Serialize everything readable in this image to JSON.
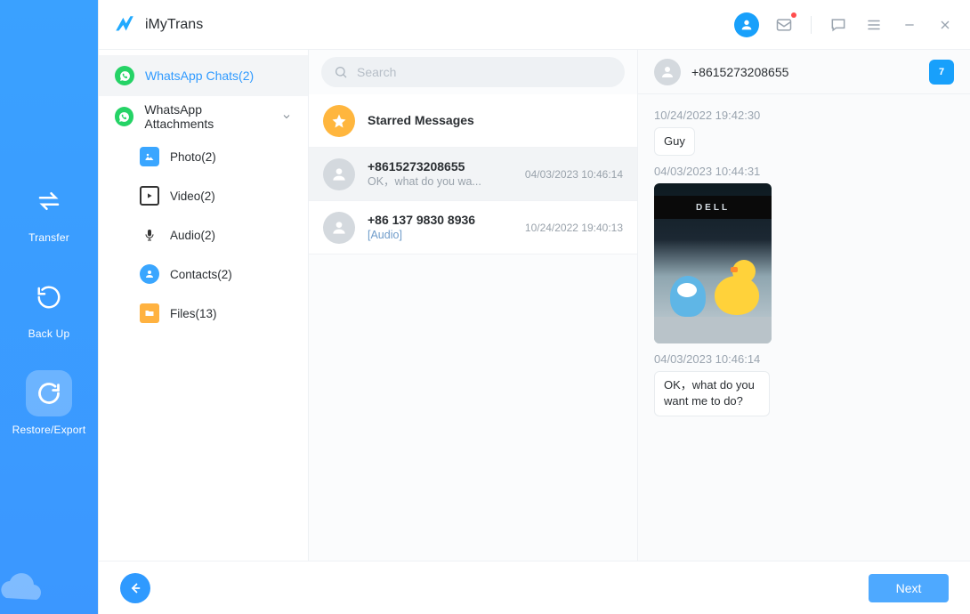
{
  "app": {
    "name": "iMyTrans"
  },
  "rail": {
    "items": [
      {
        "id": "transfer",
        "label": "Transfer"
      },
      {
        "id": "backup",
        "label": "Back Up"
      },
      {
        "id": "restore",
        "label": "Restore/Export"
      }
    ]
  },
  "tree": {
    "chats": {
      "label": "WhatsApp Chats(2)"
    },
    "attachments": {
      "label": "WhatsApp Attachments"
    },
    "photo": {
      "label": "Photo(2)"
    },
    "video": {
      "label": "Video(2)"
    },
    "audio": {
      "label": "Audio(2)"
    },
    "contacts": {
      "label": "Contacts(2)"
    },
    "files": {
      "label": "Files(13)"
    }
  },
  "search": {
    "placeholder": "Search"
  },
  "conversations": {
    "starred": {
      "title": "Starred Messages"
    },
    "items": [
      {
        "title": "+8615273208655",
        "preview": "OK，what do you wa...",
        "time": "04/03/2023 10:46:14"
      },
      {
        "title": "+86 137 9830 8936",
        "preview": "[Audio]",
        "time": "10/24/2022 19:40:13"
      }
    ]
  },
  "chat": {
    "header": {
      "title": "+8615273208655",
      "calendar_day": "7"
    },
    "messages": [
      {
        "ts": "10/24/2022 19:42:30",
        "type": "text",
        "text": "Guy"
      },
      {
        "ts": "04/03/2023 10:44:31",
        "type": "image",
        "caption": "DELL"
      },
      {
        "ts": "04/03/2023 10:46:14",
        "type": "text",
        "text": "OK，what do you want me to do?"
      }
    ]
  },
  "footer": {
    "next_label": "Next"
  }
}
